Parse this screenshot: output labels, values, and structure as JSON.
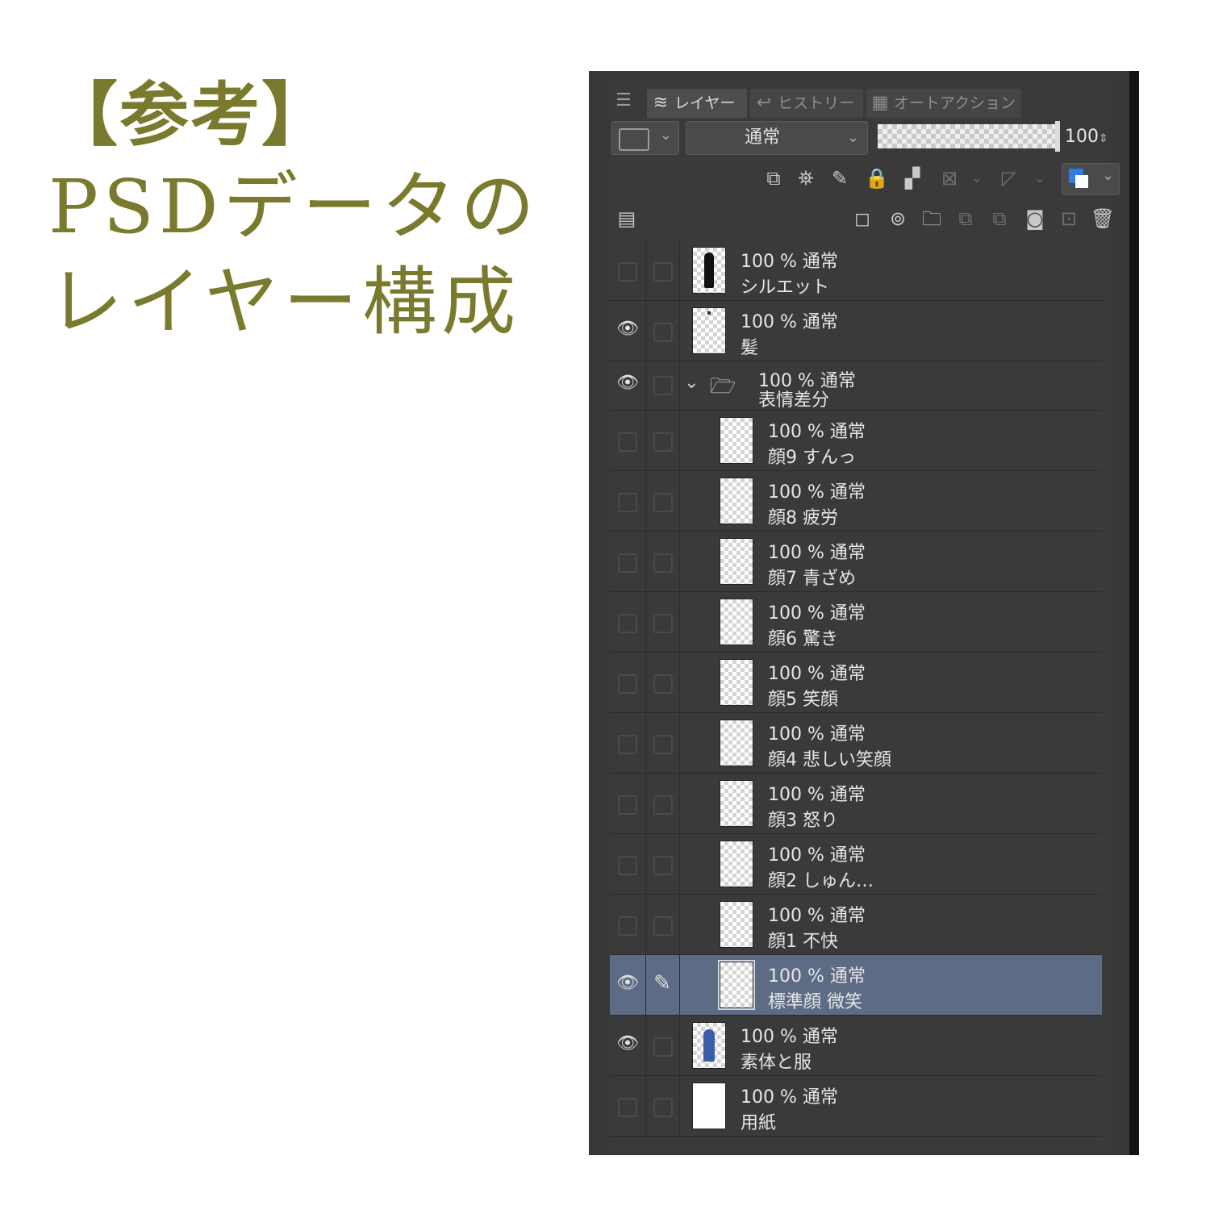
{
  "caption": {
    "title": "【参考】",
    "line1": "PSDデータの",
    "line2": "レイヤー構成"
  },
  "colors": {
    "caption": "#7a7a2e",
    "panel_bg": "#3a3a3a",
    "selected_row": "#5e6b84",
    "accent_blue": "#2f7de0"
  },
  "panel": {
    "tabs": [
      {
        "label": "レイヤー",
        "icon": "layers-icon"
      },
      {
        "label": "ヒストリー",
        "icon": "history-icon"
      },
      {
        "label": "オートアクション",
        "icon": "auto-action-icon"
      }
    ],
    "blend_mode": "通常",
    "opacity": "100",
    "opacity_fraction": 1.0
  },
  "layers": [
    {
      "props": "100 % 通常",
      "name": "シルエット",
      "visible": false,
      "thumb": "silhouette"
    },
    {
      "props": "100 % 通常",
      "name": "髪",
      "visible": true,
      "thumb": "hair"
    },
    {
      "props": "100 % 通常",
      "name": "表情差分",
      "visible": true,
      "folder": true
    },
    {
      "props": "100 % 通常",
      "name": "顔9 すんっ",
      "visible": false,
      "indent": true
    },
    {
      "props": "100 % 通常",
      "name": "顔8 疲労",
      "visible": false,
      "indent": true
    },
    {
      "props": "100 % 通常",
      "name": "顔7 青ざめ",
      "visible": false,
      "indent": true
    },
    {
      "props": "100 % 通常",
      "name": "顔6 驚き",
      "visible": false,
      "indent": true
    },
    {
      "props": "100 % 通常",
      "name": "顔5 笑顔",
      "visible": false,
      "indent": true
    },
    {
      "props": "100 % 通常",
      "name": "顔4 悲しい笑顔",
      "visible": false,
      "indent": true
    },
    {
      "props": "100 % 通常",
      "name": "顔3 怒り",
      "visible": false,
      "indent": true
    },
    {
      "props": "100 % 通常",
      "name": "顔2 しゅん…",
      "visible": false,
      "indent": true
    },
    {
      "props": "100 % 通常",
      "name": "顔1 不快",
      "visible": false,
      "indent": true
    },
    {
      "props": "100 % 通常",
      "name": "標準顔 微笑",
      "visible": true,
      "indent": true,
      "selected": true,
      "editing": true
    },
    {
      "props": "100 % 通常",
      "name": "素体と服",
      "visible": true,
      "thumb": "body"
    },
    {
      "props": "100 % 通常",
      "name": "用紙",
      "visible": false,
      "thumb": "white"
    }
  ]
}
